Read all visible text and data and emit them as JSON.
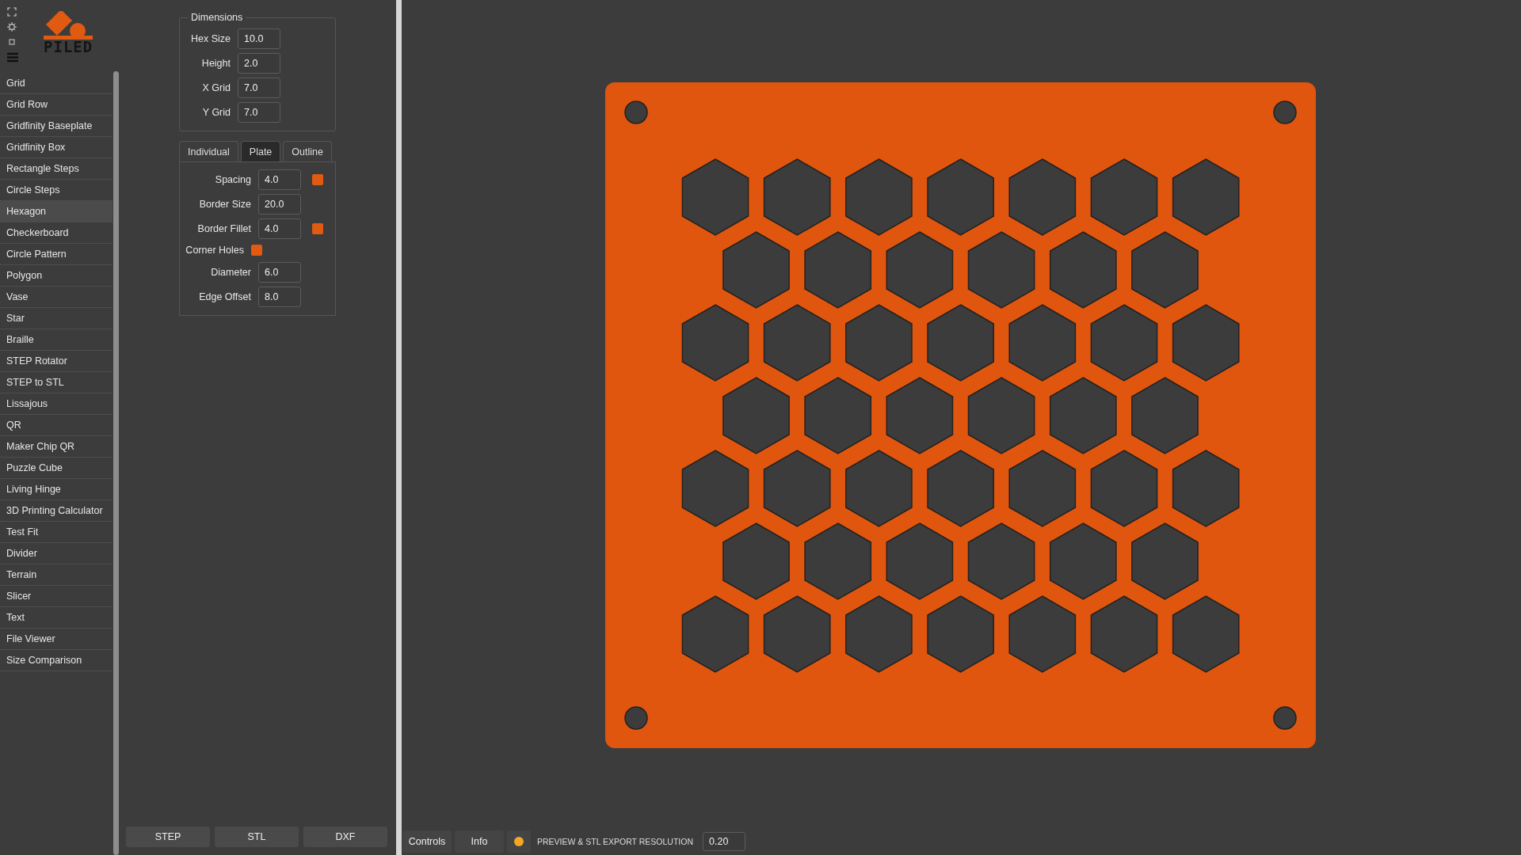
{
  "app": {
    "logo_text": "PILED"
  },
  "sidebar": {
    "items": [
      {
        "label": "Grid",
        "selected": false
      },
      {
        "label": "Grid Row",
        "selected": false
      },
      {
        "label": "Gridfinity Baseplate",
        "selected": false
      },
      {
        "label": "Gridfinity Box",
        "selected": false
      },
      {
        "label": "Rectangle Steps",
        "selected": false
      },
      {
        "label": "Circle Steps",
        "selected": false
      },
      {
        "label": "Hexagon",
        "selected": true
      },
      {
        "label": "Checkerboard",
        "selected": false
      },
      {
        "label": "Circle Pattern",
        "selected": false
      },
      {
        "label": "Polygon",
        "selected": false
      },
      {
        "label": "Vase",
        "selected": false
      },
      {
        "label": "Star",
        "selected": false
      },
      {
        "label": "Braille",
        "selected": false
      },
      {
        "label": "STEP Rotator",
        "selected": false
      },
      {
        "label": "STEP to STL",
        "selected": false
      },
      {
        "label": "Lissajous",
        "selected": false
      },
      {
        "label": "QR",
        "selected": false
      },
      {
        "label": "Maker Chip QR",
        "selected": false
      },
      {
        "label": "Puzzle Cube",
        "selected": false
      },
      {
        "label": "Living Hinge",
        "selected": false
      },
      {
        "label": "3D Printing Calculator",
        "selected": false
      },
      {
        "label": "Test Fit",
        "selected": false
      },
      {
        "label": "Divider",
        "selected": false
      },
      {
        "label": "Terrain",
        "selected": false
      },
      {
        "label": "Slicer",
        "selected": false
      },
      {
        "label": "Text",
        "selected": false
      },
      {
        "label": "File Viewer",
        "selected": false
      },
      {
        "label": "Size Comparison",
        "selected": false
      }
    ]
  },
  "dimensions": {
    "title": "Dimensions",
    "fields": [
      {
        "label": "Hex Size",
        "value": "10.0"
      },
      {
        "label": "Height",
        "value": "2.0"
      },
      {
        "label": "X Grid",
        "value": "7.0"
      },
      {
        "label": "Y Grid",
        "value": "7.0"
      }
    ]
  },
  "tabs": [
    {
      "label": "Individual",
      "selected": false
    },
    {
      "label": "Plate",
      "selected": true
    },
    {
      "label": "Outline",
      "selected": false
    }
  ],
  "plate_fields": [
    {
      "kind": "number",
      "label": "Spacing",
      "value": "4.0",
      "checked": true
    },
    {
      "kind": "number",
      "label": "Border Size",
      "value": "20.0"
    },
    {
      "kind": "number",
      "label": "Border Fillet",
      "value": "4.0",
      "checked": true
    },
    {
      "kind": "toggle",
      "label": "Corner Holes",
      "checked": true
    },
    {
      "kind": "number",
      "label": "Diameter",
      "value": "6.0"
    },
    {
      "kind": "number",
      "label": "Edge Offset",
      "value": "8.0"
    }
  ],
  "export_buttons": [
    "STEP",
    "STL",
    "DXF"
  ],
  "bottom_bar": {
    "tabs": [
      "Controls",
      "Info"
    ],
    "resolution_label": "PREVIEW & STL EXPORT RESOLUTION",
    "resolution_value": "0.20"
  }
}
